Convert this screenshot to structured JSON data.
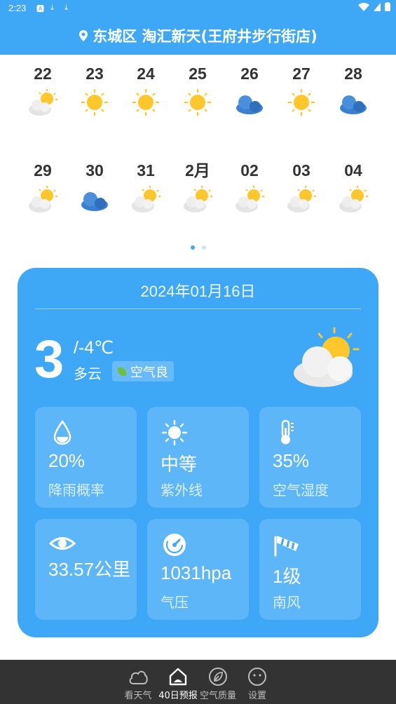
{
  "status_bar": {
    "time": "2:23"
  },
  "header": {
    "location": "东城区 淘汇新天(王府井步行街店)"
  },
  "calendar": {
    "days": [
      {
        "label": "22",
        "icon": "partly-cloudy-icon"
      },
      {
        "label": "23",
        "icon": "sunny-icon"
      },
      {
        "label": "24",
        "icon": "sunny-icon"
      },
      {
        "label": "25",
        "icon": "sunny-icon"
      },
      {
        "label": "26",
        "icon": "overcast-icon"
      },
      {
        "label": "27",
        "icon": "sunny-icon"
      },
      {
        "label": "28",
        "icon": "overcast-icon"
      },
      {
        "label": "29",
        "icon": "partly-cloudy-icon"
      },
      {
        "label": "30",
        "icon": "overcast-icon"
      },
      {
        "label": "31",
        "icon": "partly-cloudy-icon"
      },
      {
        "label": "2月",
        "icon": "partly-cloudy-icon"
      },
      {
        "label": "02",
        "icon": "partly-cloudy-icon"
      },
      {
        "label": "03",
        "icon": "partly-cloudy-icon"
      },
      {
        "label": "04",
        "icon": "partly-cloudy-icon"
      }
    ]
  },
  "today": {
    "date": "2024年01月16日",
    "temp": "3",
    "low": "/-4℃",
    "condition": "多云",
    "air_quality": "空气良",
    "icon": "partly-cloudy-icon",
    "details": [
      {
        "value": "20%",
        "label": "降雨概率",
        "icon": "raindrop-icon"
      },
      {
        "value": "中等",
        "label": "紫外线",
        "icon": "sun-icon"
      },
      {
        "value": "35%",
        "label": "空气湿度",
        "icon": "thermometer-icon"
      },
      {
        "value": "33.57公里",
        "label": "",
        "icon": "eye-icon"
      },
      {
        "value": "1031hpa",
        "label": "气压",
        "icon": "gauge-icon"
      },
      {
        "value": "1级",
        "label": "南风",
        "icon": "windsock-icon"
      }
    ]
  },
  "bottom_nav": [
    {
      "label": "看天气",
      "icon": "cloud-icon"
    },
    {
      "label": "40日预报",
      "icon": "home-icon"
    },
    {
      "label": "空气质量",
      "icon": "leaf-icon"
    },
    {
      "label": "设置",
      "icon": "face-icon"
    }
  ],
  "colors": {
    "primary": "#3ea8f7",
    "nav_bg": "#333333",
    "sun": "#ffc72c"
  }
}
